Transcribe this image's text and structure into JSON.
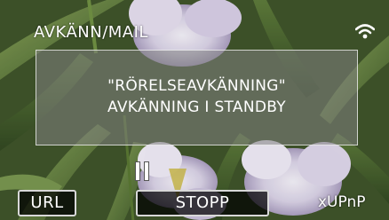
{
  "status": {
    "mode_title": "AVKÄNN/MAIL",
    "wifi_icon": "wifi-icon"
  },
  "message": {
    "line1": "\"RÖRELSEAVKÄNNING\"",
    "line2": "AVKÄNNING I STANDBY"
  },
  "controls": {
    "pause_icon": "pause-icon",
    "url_label": "URL",
    "stop_label": "STOPP",
    "upnp_label": "xUPnP"
  },
  "colors": {
    "button_border": "#d8d8d8",
    "button_bg": "#000000",
    "text": "#ffffff"
  }
}
